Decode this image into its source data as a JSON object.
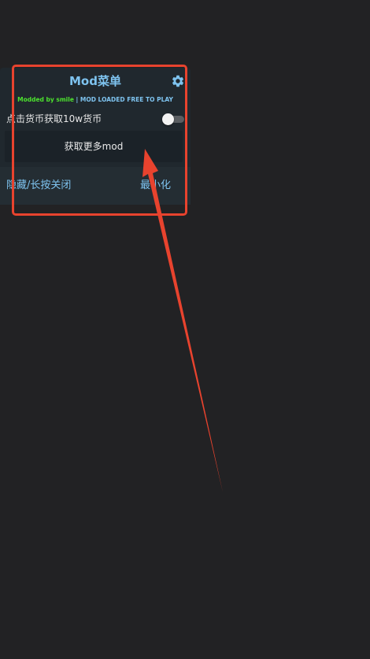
{
  "menu": {
    "title": "Mod菜单",
    "subtitle_author": "Modded by smile",
    "subtitle_separator": " | ",
    "subtitle_status": "MOD LOADED FREE TO PLAY",
    "settings_icon": "gear-icon"
  },
  "toggle": {
    "label": "点击货币获取10w货币",
    "enabled": false
  },
  "more_button": {
    "label": "获取更多mod"
  },
  "footer": {
    "hide_label": "隐藏/长按关闭",
    "minimize_label": "最小化"
  },
  "annotation": {
    "color": "#e8432e"
  },
  "colors": {
    "background": "#222224",
    "panel": "#20282e",
    "accent": "#7ec3ef",
    "author_green": "#4ce22e"
  }
}
